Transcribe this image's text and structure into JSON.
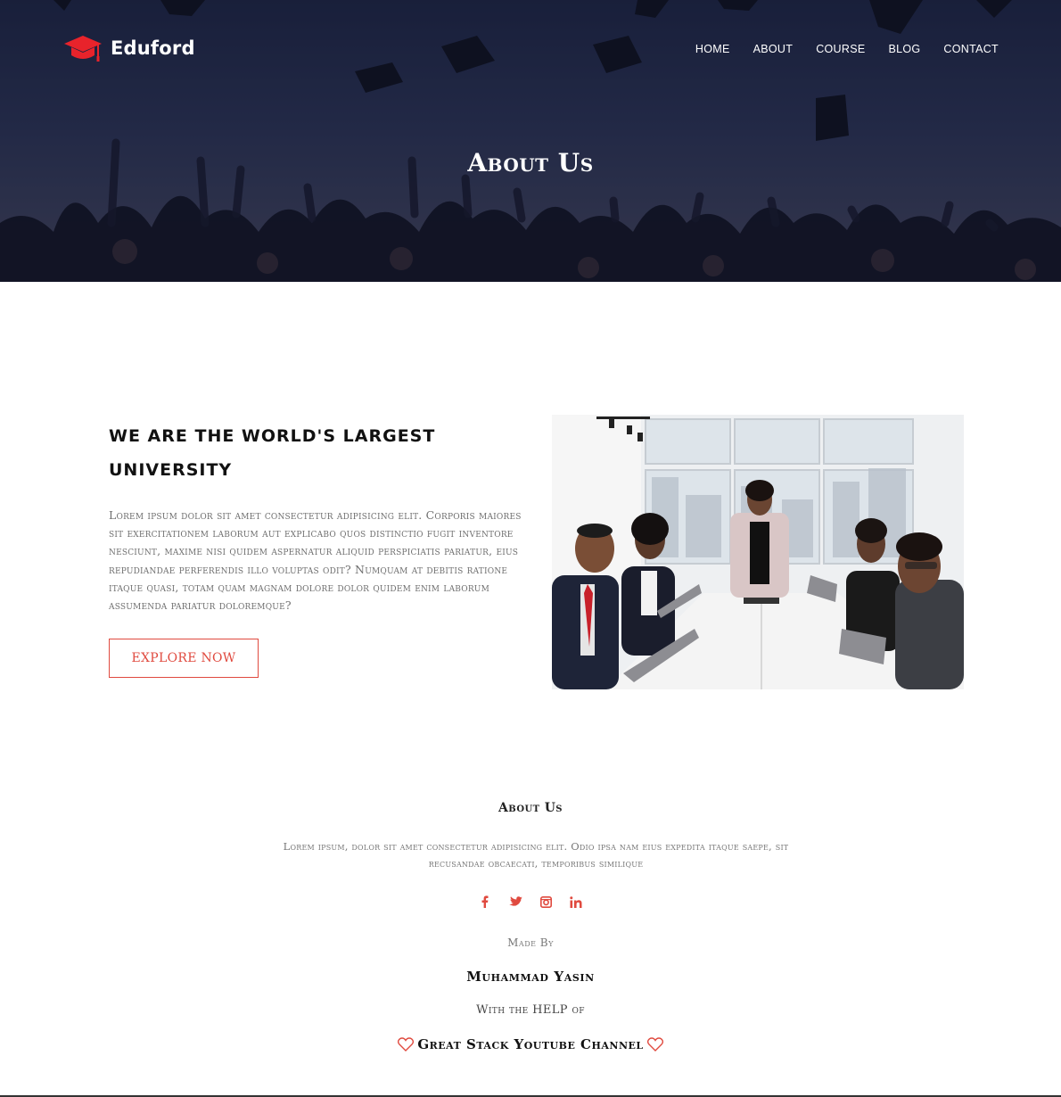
{
  "brand": {
    "name": "Eduford",
    "accent": "#e8232b"
  },
  "nav": {
    "items": [
      "HOME",
      "ABOUT",
      "COURSE",
      "BLOG",
      "CONTACT"
    ]
  },
  "hero": {
    "title": "About Us"
  },
  "about": {
    "heading": "WE ARE THE WORLD'S LARGEST UNIVERSITY",
    "paragraph": "Lorem ipsum dolor sit amet consectetur adipisicing elit. Corporis maiores sit exercitationem laborum aut explicabo quos distinctio fugit inventore nesciunt, maxime nisi quidem aspernatur aliquid perspiciatis pariatur, eius repudiandae perferendis illo voluptas odit? Numquam at debitis ratione itaque quasi, totam quam magnam dolore dolor quidem enim laborum assumenda pariatur doloremque?",
    "button_label": "EXPLORE NOW",
    "button_color": "#e04a3f"
  },
  "footer": {
    "title": "About Us",
    "text": "Lorem ipsum, dolor sit amet consectetur adipisicing elit. Odio ipsa nam eius expedita itaque saepe, sit recusandae obcaecati, temporibus similique",
    "social_icons": [
      "facebook-icon",
      "twitter-icon",
      "instagram-icon",
      "linkedin-icon"
    ],
    "social_color": "#e04a3f",
    "made_by_label": "Made By",
    "author": "Muhammad Yasin",
    "help_label": "With the HELP of",
    "channel": "Great Stack Youtube Channel"
  }
}
